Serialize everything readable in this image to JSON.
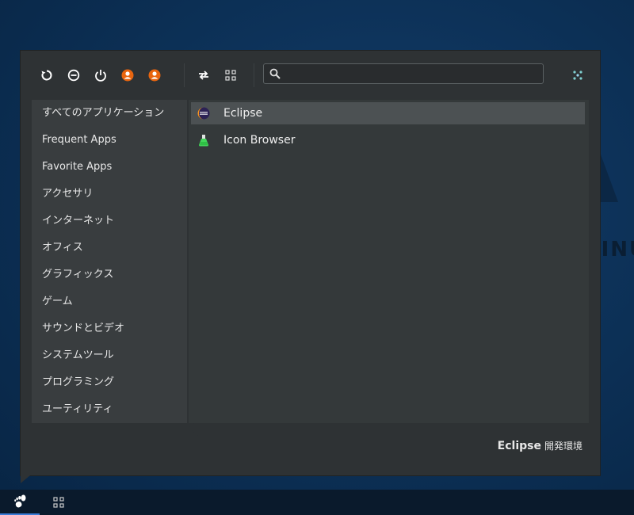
{
  "toolbar": {
    "icons": [
      "refresh-icon",
      "lock-icon",
      "power-icon",
      "user-icon",
      "user-switch-icon",
      "swap-view-icon",
      "grid-view-icon",
      "settings-icon"
    ],
    "accent_color": "#e8650f",
    "search": {
      "placeholder": "",
      "value": ""
    }
  },
  "sidebar": {
    "categories": [
      "すべてのアプリケーション",
      "Frequent Apps",
      "Favorite Apps",
      "アクセサリ",
      "インターネット",
      "オフィス",
      "グラフィックス",
      "ゲーム",
      "サウンドとビデオ",
      "システムツール",
      "プログラミング",
      "ユーティリティ"
    ],
    "selected": "プログラミング"
  },
  "apps": {
    "items": [
      {
        "name": "Eclipse",
        "icon": "eclipse-icon",
        "selected": true
      },
      {
        "name": "Icon Browser",
        "icon": "icon-browser-icon",
        "selected": false
      }
    ]
  },
  "description": {
    "name": "Eclipse",
    "text": "開発環境"
  },
  "taskbar": {
    "launcher_icon": "gnome-foot-icon",
    "apps_icon": "grid-view-icon",
    "accent_color": "#3b7dd8"
  }
}
